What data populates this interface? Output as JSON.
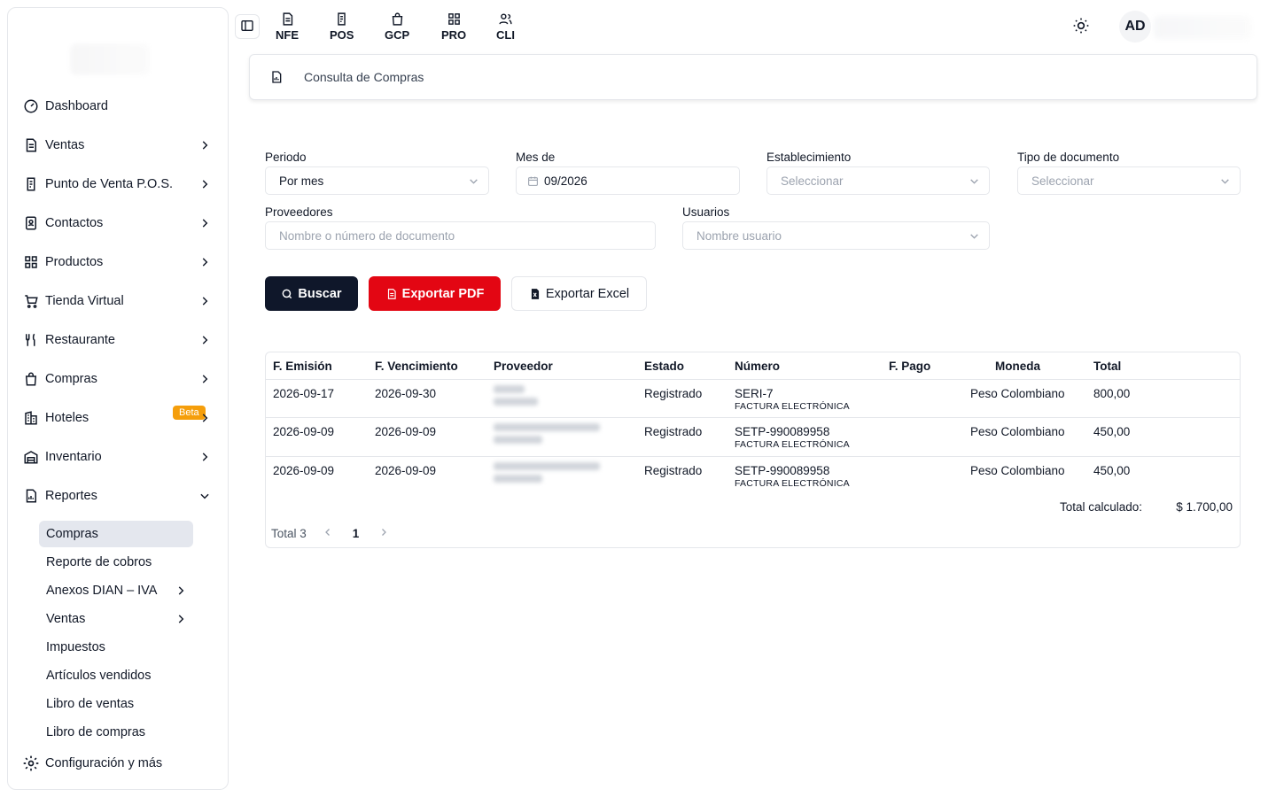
{
  "sidebar": {
    "items": [
      {
        "label": "Dashboard",
        "icon": "gauge-icon"
      },
      {
        "label": "Ventas",
        "icon": "document-icon"
      },
      {
        "label": "Punto de Venta P.O.S.",
        "icon": "pos-receipt-icon"
      },
      {
        "label": "Contactos",
        "icon": "contacts-book-icon"
      },
      {
        "label": "Productos",
        "icon": "grid-icon"
      },
      {
        "label": "Tienda Virtual",
        "icon": "cart-icon"
      },
      {
        "label": "Restaurante",
        "icon": "utensils-icon"
      },
      {
        "label": "Compras",
        "icon": "shopping-bag-icon"
      },
      {
        "label": "Hoteles",
        "icon": "hotel-icon",
        "badge": "Beta"
      },
      {
        "label": "Inventario",
        "icon": "warehouse-icon"
      },
      {
        "label": "Reportes",
        "icon": "report-icon"
      }
    ],
    "subitems": [
      {
        "label": "Compras"
      },
      {
        "label": "Reporte de cobros"
      },
      {
        "label": "Anexos DIAN – IVA"
      },
      {
        "label": "Ventas"
      },
      {
        "label": "Impuestos"
      },
      {
        "label": "Artículos vendidos"
      },
      {
        "label": "Libro de ventas"
      },
      {
        "label": "Libro de compras"
      }
    ],
    "settings_label": "Configuración y más"
  },
  "topbar": {
    "apps": [
      {
        "label": "NFE",
        "icon": "invoice-icon"
      },
      {
        "label": "POS",
        "icon": "pos-icon"
      },
      {
        "label": "GCP",
        "icon": "bag-icon"
      },
      {
        "label": "PRO",
        "icon": "apps-grid-icon"
      },
      {
        "label": "CLI",
        "icon": "users-icon"
      }
    ],
    "avatar_initials": "AD"
  },
  "page": {
    "title": "Consulta de Compras"
  },
  "filters": {
    "periodo_label": "Periodo",
    "periodo_value": "Por mes",
    "mes_label": "Mes de",
    "mes_value": "09/2026",
    "establecimiento_label": "Establecimiento",
    "establecimiento_placeholder": "Seleccionar",
    "tipo_label": "Tipo de documento",
    "tipo_placeholder": "Seleccionar",
    "proveedores_label": "Proveedores",
    "proveedores_placeholder": "Nombre o número de documento",
    "usuarios_label": "Usuarios",
    "usuarios_placeholder": "Nombre usuario"
  },
  "actions": {
    "search_label": "Buscar",
    "pdf_label": "Exportar PDF",
    "excel_label": "Exportar Excel"
  },
  "table": {
    "headers": [
      "F. Emisión",
      "F. Vencimiento",
      "Proveedor",
      "Estado",
      "Número",
      "F. Pago",
      "Moneda",
      "Total"
    ],
    "rows": [
      {
        "emision": "2026-09-17",
        "vencimiento": "2026-09-30",
        "estado": "Registrado",
        "numero": "SERI-7",
        "tipo": "FACTURA ELECTRÓNICA",
        "pago": "",
        "moneda": "Peso Colombiano",
        "total": "800,00"
      },
      {
        "emision": "2026-09-09",
        "vencimiento": "2026-09-09",
        "estado": "Registrado",
        "numero": "SETP-990089958",
        "tipo": "FACTURA ELECTRÓNICA",
        "pago": "",
        "moneda": "Peso Colombiano",
        "total": "450,00"
      },
      {
        "emision": "2026-09-09",
        "vencimiento": "2026-09-09",
        "estado": "Registrado",
        "numero": "SETP-990089958",
        "tipo": "FACTURA ELECTRÓNICA",
        "pago": "",
        "moneda": "Peso Colombiano",
        "total": "450,00"
      }
    ],
    "total_label": "Total calculado:",
    "total_value": "$ 1.700,00",
    "pager_total": "Total 3",
    "current_page": "1"
  }
}
